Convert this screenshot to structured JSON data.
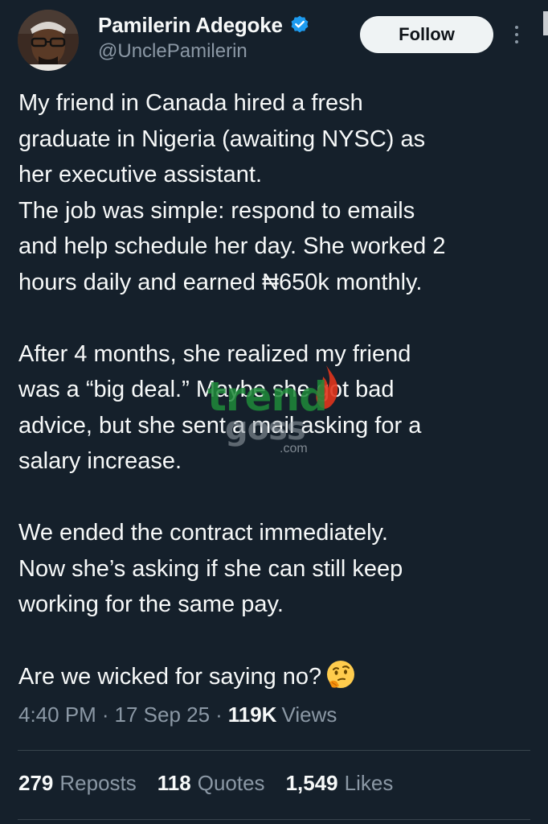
{
  "author": {
    "display_name": "Pamilerin Adegoke",
    "handle": "@UnclePamilerin",
    "verified": true
  },
  "header": {
    "follow_label": "Follow"
  },
  "tweet": {
    "paragraphs": [
      "My friend in Canada hired a fresh\ngraduate in Nigeria (awaiting NYSC) as\nher executive assistant.\nThe job was simple: respond to emails\nand help schedule her day. She worked 2\nhours daily and earned ₦650k monthly.",
      "After 4 months, she realized my friend\nwas a “big deal.” Maybe she got bad\nadvice, but she sent a mail asking for a\nsalary increase.",
      "We ended the contract immediately.\nNow she’s asking if she can still keep\nworking for the same pay.",
      "Are we wicked for saying no?"
    ],
    "emoji": "thinking-face"
  },
  "watermark": {
    "top": "trend",
    "bottom": "goss",
    "suffix": ".com"
  },
  "meta": {
    "time": "4:40 PM",
    "date": "17 Sep 25",
    "separator": "·",
    "views_count": "119K",
    "views_label": "Views"
  },
  "stats": {
    "reposts_count": "279",
    "reposts_label": "Reposts",
    "quotes_count": "118",
    "quotes_label": "Quotes",
    "likes_count": "1,549",
    "likes_label": "Likes"
  },
  "colors": {
    "background": "#15202b",
    "text_primary": "#f7f9f9",
    "text_secondary": "#8b98a5",
    "verified_blue": "#1d9bf0",
    "divider": "#38444d",
    "follow_bg": "#eff3f4"
  }
}
